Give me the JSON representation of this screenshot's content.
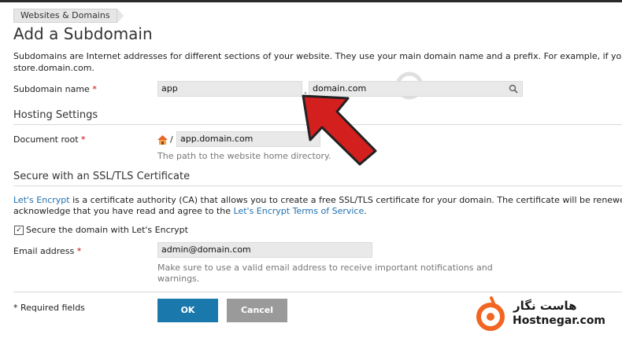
{
  "breadcrumb": "Websites & Domains",
  "page_title": "Add a Subdomain",
  "intro": {
    "line1": "Subdomains are Internet addresses for different sections of your website. They use your main domain name and a prefix. For example, if your domain",
    "line2": "store.domain.com."
  },
  "subdomain": {
    "label": "Subdomain name",
    "required_mark": "*",
    "value": "app",
    "dot": ".",
    "domain_value": "domain.com"
  },
  "hosting": {
    "title": "Hosting Settings",
    "doc_root_label": "Document root",
    "required_mark": "*",
    "slash": "/",
    "doc_root_value": "app.domain.com",
    "doc_root_hint": "The path to the website home directory."
  },
  "ssl": {
    "title": "Secure with an SSL/TLS Certificate",
    "lets_encrypt_link": "Let's Encrypt",
    "para1_rest": " is a certificate authority (CA) that allows you to create a free SSL/TLS certificate for your domain. The certificate will be renewed automatic",
    "para2_start": "acknowledge that you have read and agree to the ",
    "terms_link": "Let's Encrypt Terms of Service",
    "para2_end": ".",
    "checkbox_label": "Secure the domain with Let's Encrypt",
    "checkbox_checked": true,
    "email_label": "Email address",
    "required_mark": "*",
    "email_value": "admin@domain.com",
    "email_hint_1": "Make sure to use a valid email address to receive important notifications and",
    "email_hint_2": "warnings."
  },
  "footer": {
    "required_note": "* Required fields",
    "ok_label": "OK",
    "cancel_label": "Cancel"
  },
  "brand": {
    "name_fa": "هاست نگار",
    "name_en": "Hostnegar.com"
  },
  "colors": {
    "link": "#1e6fb0",
    "ok_button": "#1b78ad",
    "cancel_button": "#9a9a9a",
    "arrow": "#d41f1f",
    "brand_orange": "#f26522"
  }
}
